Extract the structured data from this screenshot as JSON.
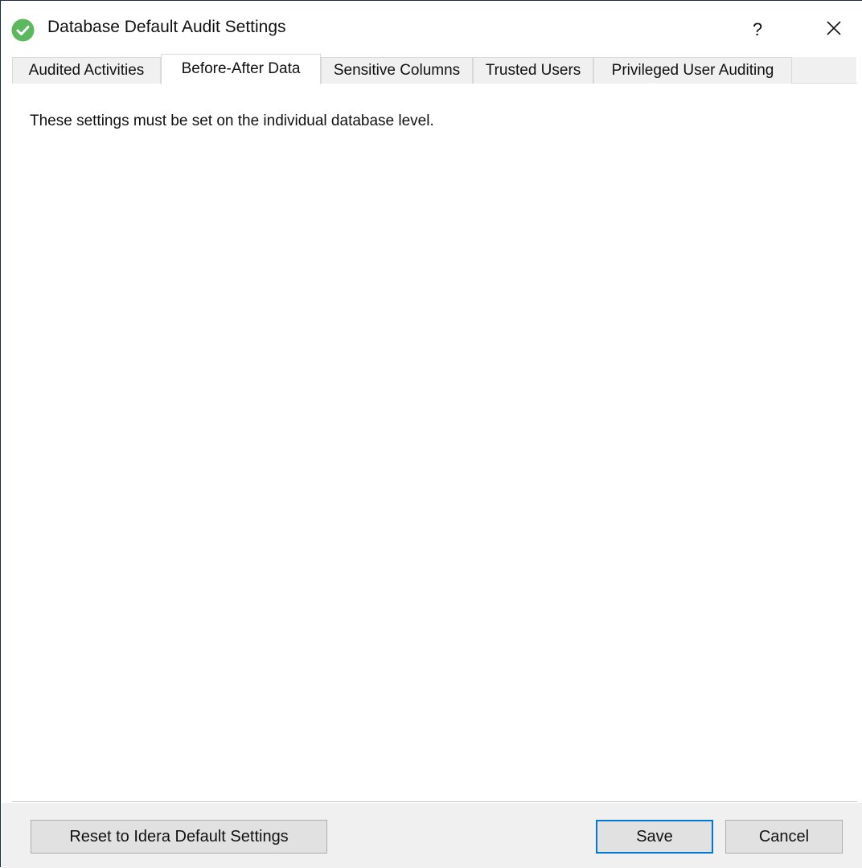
{
  "window": {
    "title": "Database Default Audit Settings",
    "help_label": "?",
    "icon": "check-circle-icon",
    "accent_color": "#5cb85c"
  },
  "tabs": [
    {
      "label": "Audited Activities",
      "active": false
    },
    {
      "label": "Before-After Data",
      "active": true
    },
    {
      "label": "Sensitive Columns",
      "active": false
    },
    {
      "label": "Trusted Users",
      "active": false
    },
    {
      "label": "Privileged User Auditing",
      "active": false
    }
  ],
  "content": {
    "message": "These settings must be set on the individual database level."
  },
  "footer": {
    "reset_label": "Reset to Idera Default Settings",
    "save_label": "Save",
    "cancel_label": "Cancel"
  }
}
